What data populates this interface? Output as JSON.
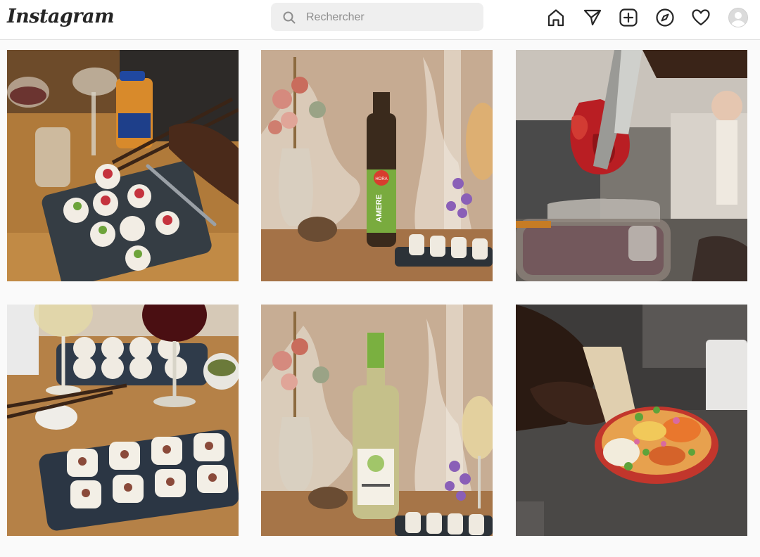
{
  "app": {
    "logo_text": "Instagram"
  },
  "search": {
    "placeholder": "Rechercher",
    "icon": "search-icon"
  },
  "nav": {
    "icons": [
      "home-icon",
      "direct-messages-icon",
      "new-post-icon",
      "explore-icon",
      "activity-heart-icon",
      "profile-avatar"
    ]
  },
  "posts": [
    {
      "subject": "sushi-rolls-with-chopsticks-and-wine"
    },
    {
      "subject": "bottle-labelled-amere-with-dried-flowers",
      "label_brand": "HORA",
      "label_text": "AMERE"
    },
    {
      "subject": "tongs-holding-red-flowers-over-jar"
    },
    {
      "subject": "sushi-plates-and-wine-glasses"
    },
    {
      "subject": "white-wine-bottle-with-dried-flowers"
    },
    {
      "subject": "hand-garnishing-poke-bowl"
    }
  ],
  "colors": {
    "bar_border": "#dbdbdb",
    "page_bg": "#fafafa",
    "icon": "#262626",
    "search_bg": "#efefef"
  }
}
